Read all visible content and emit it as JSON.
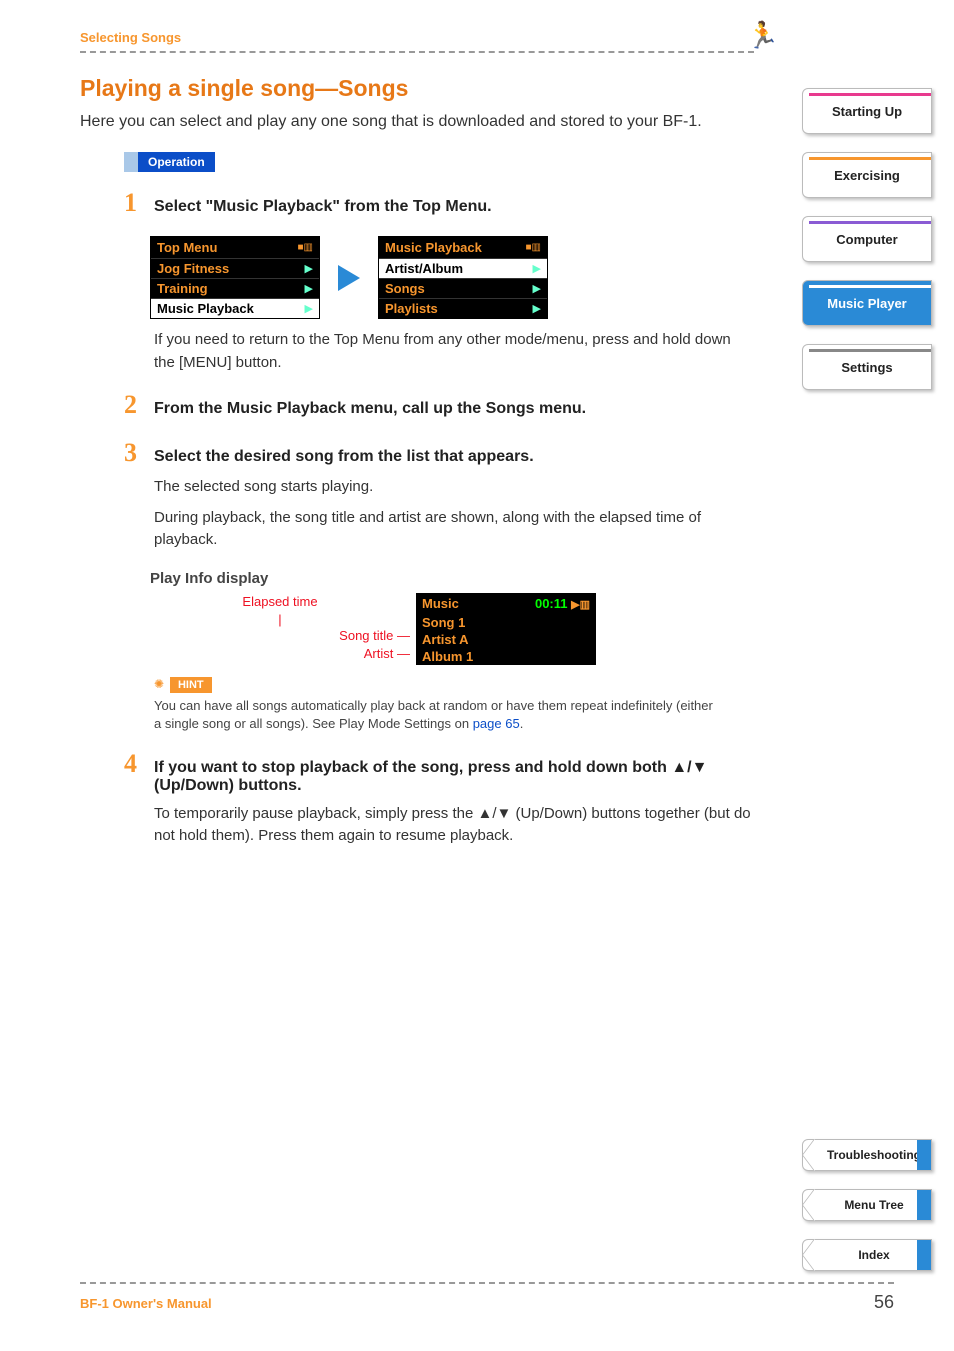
{
  "header": {
    "section": "Selecting Songs"
  },
  "page": {
    "title": "Playing a single song—Songs",
    "intro": "Here you can select and play any one song that is downloaded and stored to your BF-1.",
    "operation_label": "Operation"
  },
  "side_tabs_top": [
    {
      "label": "Starting Up",
      "cls": "pink"
    },
    {
      "label": "Exercising",
      "cls": "orange"
    },
    {
      "label": "Computer",
      "cls": "purple"
    },
    {
      "label": "Music Player",
      "cls": "blue"
    },
    {
      "label": "Settings",
      "cls": "grey"
    }
  ],
  "side_tabs_bottom": [
    {
      "label": "Troubleshooting"
    },
    {
      "label": "Menu Tree"
    },
    {
      "label": "Index"
    }
  ],
  "steps": {
    "s1": {
      "num": "1",
      "title": "Select \"Music Playback\" from the Top Menu.",
      "note": "If you need to return to the Top Menu from any other mode/menu, press and hold down the [MENU] button."
    },
    "s2": {
      "num": "2",
      "title": "From the Music Playback menu, call up the Songs menu."
    },
    "s3": {
      "num": "3",
      "title": "Select the desired song from the list that appears.",
      "body1": "The selected song starts playing.",
      "body2": "During playback, the song title and artist are shown, along with the elapsed time of playback."
    },
    "s4": {
      "num": "4",
      "title": "If you want to stop playback of the song, press and hold down both ▲/▼ (Up/Down) buttons.",
      "body": "To temporarily pause playback, simply press the ▲/▼ (Up/Down) buttons together (but do not hold them). Press them again to resume playback."
    }
  },
  "screen1": {
    "title": "Top Menu",
    "items": [
      "Jog Fitness",
      "Training",
      "Music Playback"
    ],
    "selected_idx": 2
  },
  "screen2": {
    "title": "Music Playback",
    "items": [
      "Artist/Album",
      "Songs",
      "Playlists"
    ],
    "selected_idx": 0
  },
  "playinfo": {
    "heading": "Play Info display",
    "elapsed_caption": "Elapsed time",
    "song_title_label": "Song title",
    "artist_label": "Artist",
    "screen": {
      "head_left": "Music",
      "elapsed": "00:11",
      "song": "Song 1",
      "artist": "Artist A",
      "album": "Album 1"
    }
  },
  "hint": {
    "label": "HINT",
    "text_a": "You can have all songs automatically play back at random or have them repeat indefinitely (either a single song or all songs). See Play Mode Settings on ",
    "link_text": "page 65",
    "text_b": "."
  },
  "footer": {
    "manual": "BF-1 Owner's Manual",
    "page": "56"
  }
}
